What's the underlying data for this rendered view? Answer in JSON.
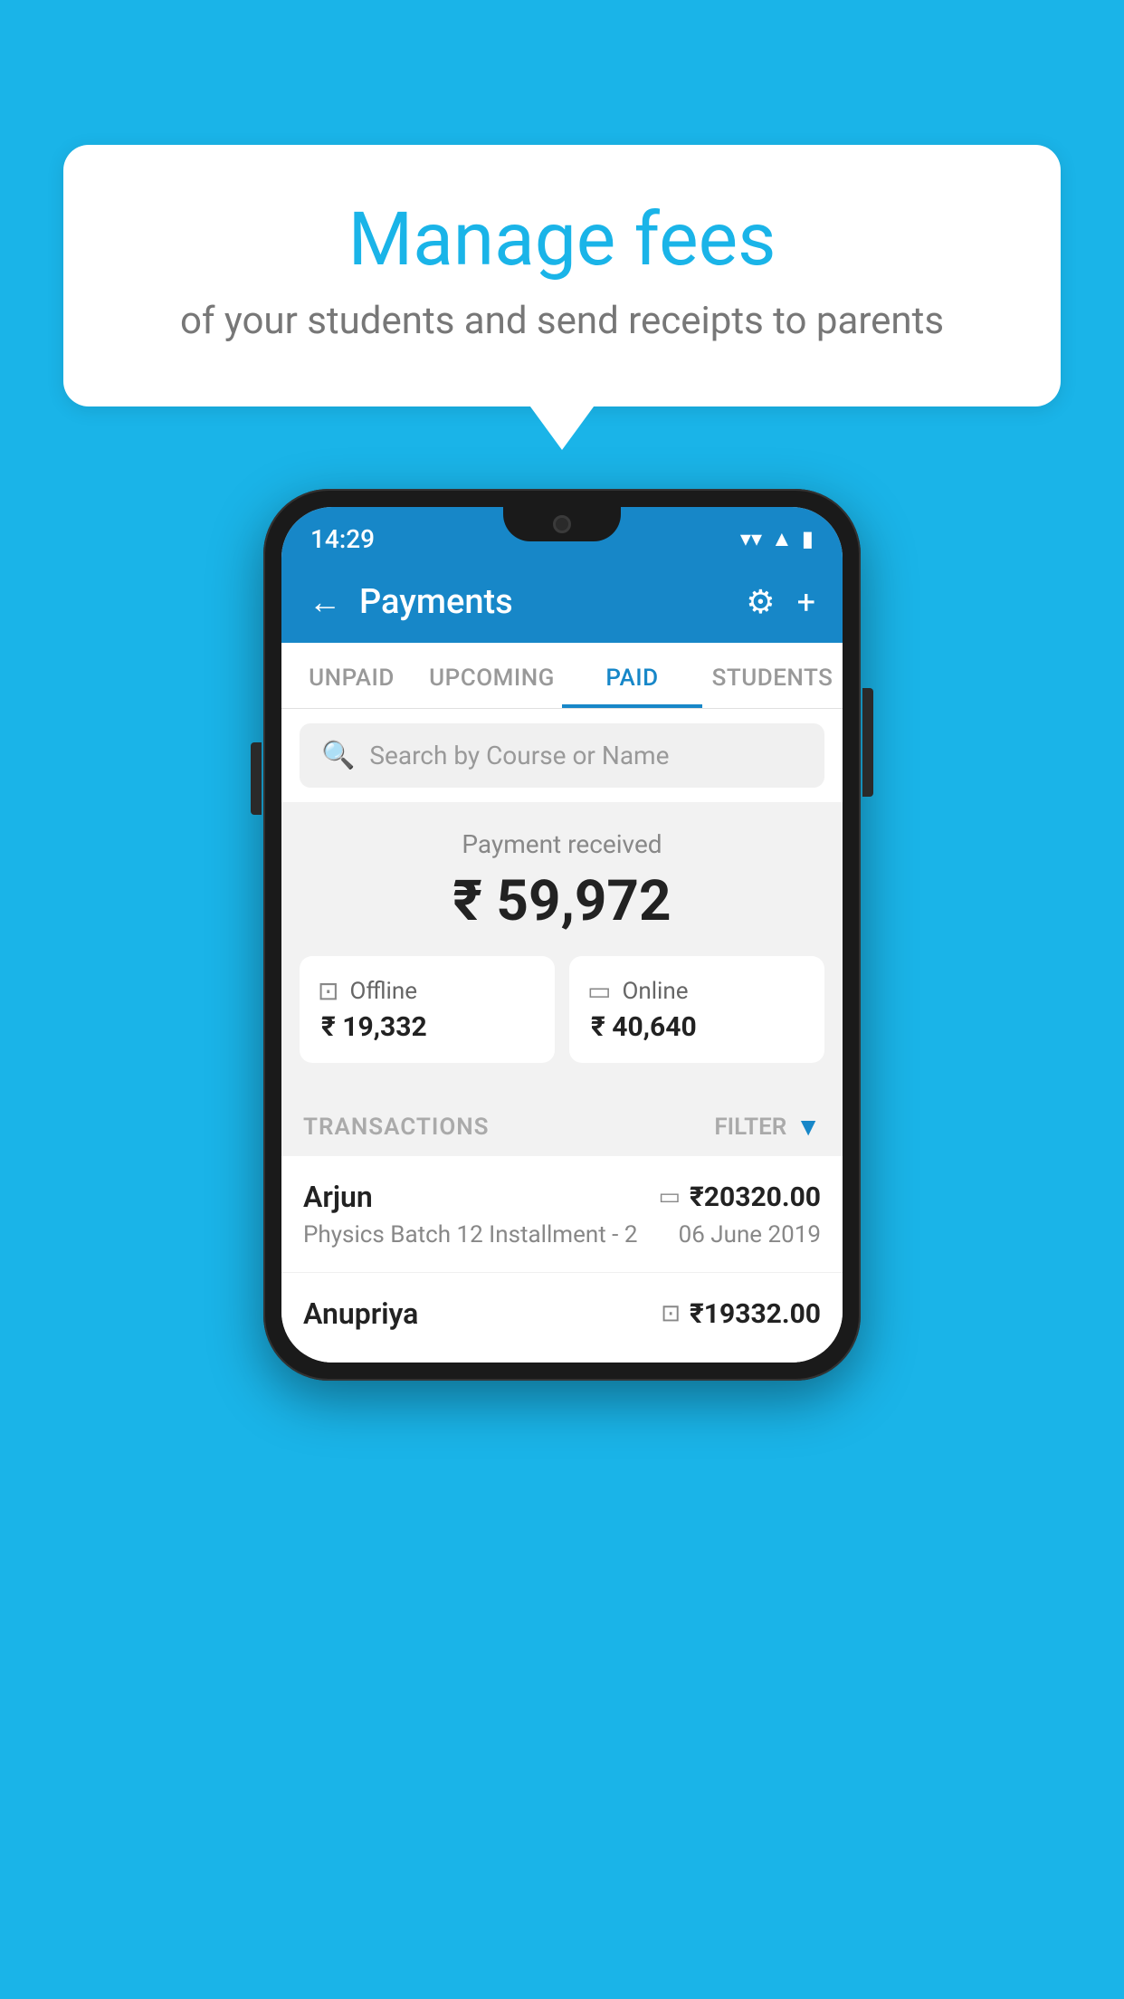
{
  "page": {
    "background_color": "#1ab4e8"
  },
  "bubble": {
    "title": "Manage fees",
    "subtitle": "of your students and send receipts to parents"
  },
  "status_bar": {
    "time": "14:29",
    "icons": [
      "wifi",
      "signal",
      "battery"
    ]
  },
  "header": {
    "title": "Payments",
    "back_label": "←",
    "gear_label": "⚙",
    "plus_label": "+"
  },
  "tabs": [
    {
      "label": "UNPAID",
      "active": false
    },
    {
      "label": "UPCOMING",
      "active": false
    },
    {
      "label": "PAID",
      "active": true
    },
    {
      "label": "STUDENTS",
      "active": false
    }
  ],
  "search": {
    "placeholder": "Search by Course or Name"
  },
  "payment": {
    "label": "Payment received",
    "amount": "₹ 59,972",
    "offline": {
      "label": "Offline",
      "amount": "₹ 19,332"
    },
    "online": {
      "label": "Online",
      "amount": "₹ 40,640"
    }
  },
  "transactions": {
    "section_label": "TRANSACTIONS",
    "filter_label": "FILTER",
    "rows": [
      {
        "name": "Arjun",
        "course": "Physics Batch 12 Installment - 2",
        "amount": "₹20320.00",
        "date": "06 June 2019",
        "type": "online"
      },
      {
        "name": "Anupriya",
        "course": "",
        "amount": "₹19332.00",
        "date": "",
        "type": "offline"
      }
    ]
  }
}
